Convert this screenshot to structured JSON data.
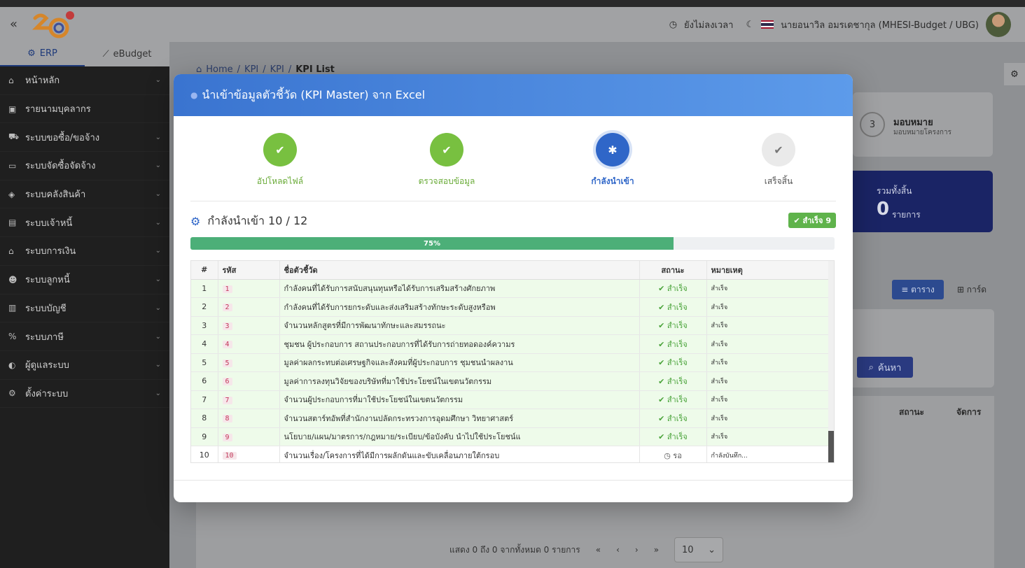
{
  "header": {
    "collapse_icon": "«",
    "clock_status": "ยังไม่ลงเวลา",
    "user_name": "นายอนาวิล อมรเดชากุล (MHESI-Budget / UBG)"
  },
  "module_tabs": [
    {
      "label": "ERP",
      "icon": "gears-icon",
      "active": true
    },
    {
      "label": "eBudget",
      "icon": "chart-line-icon",
      "active": false
    }
  ],
  "sidebar": {
    "items": [
      {
        "label": "หน้าหลัก",
        "icon": "⌂"
      },
      {
        "label": "รายนามบุคลากร",
        "icon": "▣"
      },
      {
        "label": "ระบบขอซื้อ/ขอจ้าง",
        "icon": "⛟"
      },
      {
        "label": "ระบบจัดซื้อจัดจ้าง",
        "icon": "▭"
      },
      {
        "label": "ระบบคลังสินค้า",
        "icon": "◈"
      },
      {
        "label": "ระบบเจ้าหนี้",
        "icon": "▤"
      },
      {
        "label": "ระบบการเงิน",
        "icon": "⌂"
      },
      {
        "label": "ระบบลูกหนี้",
        "icon": "☻"
      },
      {
        "label": "ระบบบัญชี",
        "icon": "▥"
      },
      {
        "label": "ระบบภาษี",
        "icon": "%"
      },
      {
        "label": "ผู้ดูแลระบบ",
        "icon": "◐"
      },
      {
        "label": "ตั้งค่าระบบ",
        "icon": "⚙"
      }
    ]
  },
  "breadcrumb": {
    "items": [
      "Home",
      "KPI",
      "KPI"
    ],
    "current": "KPI List",
    "separator": "/"
  },
  "background": {
    "step3_number": "3",
    "step3_title": "มอบหมาย",
    "step3_sub": "มอบหมายโครงการ",
    "total_label": "รวมทั้งสิ้น",
    "total_value": "0",
    "total_unit": "รายการ",
    "view_table": "≡ ตาราง",
    "view_card": "⊞ การ์ด",
    "search_label": "ค้นหา",
    "col_status": "สถานะ",
    "col_manage": "จัดการ",
    "pager_text": "แสดง 0 ถึง 0 จากทั้งหมด 0 รายการ",
    "pager_first": "«",
    "pager_prev": "‹",
    "pager_next": "›",
    "pager_last": "»",
    "page_size": "10"
  },
  "modal": {
    "title": "นำเข้าข้อมูลตัวชี้วัด (KPI Master) จาก Excel",
    "steps": [
      {
        "label": "อัปโหลดไฟล์",
        "state": "done",
        "icon": "✔"
      },
      {
        "label": "ตรวจสอบข้อมูล",
        "state": "done",
        "icon": "✔"
      },
      {
        "label": "กำลังนำเข้า",
        "state": "active",
        "icon": "✱"
      },
      {
        "label": "เสร็จสิ้น",
        "state": "pending",
        "icon": "✔"
      }
    ],
    "progress_title": "กำลังนำเข้า 10 / 12",
    "success_badge": "✔ สำเร็จ 9",
    "progress_percent": 75,
    "progress_label": "75%",
    "table": {
      "headers": [
        "#",
        "รหัส",
        "ชื่อตัวชี้วัด",
        "สถานะ",
        "หมายเหตุ"
      ],
      "rows": [
        {
          "idx": "1",
          "code": "1",
          "name": "กำลังคนที่ได้รับการสนับสนุนทุนหรือได้รับการเสริมสร้างศักยภาพ",
          "status": "สำเร็จ",
          "state": "ok",
          "note": "สำเร็จ"
        },
        {
          "idx": "2",
          "code": "2",
          "name": "กำลังคนที่ได้รับการยกระดับและส่งเสริมสร้างทักษะระดับสูงหรือพ",
          "status": "สำเร็จ",
          "state": "ok",
          "note": "สำเร็จ"
        },
        {
          "idx": "3",
          "code": "3",
          "name": "จำนวนหลักสูตรที่มีการพัฒนาทักษะและสมรรถนะ",
          "status": "สำเร็จ",
          "state": "ok",
          "note": "สำเร็จ"
        },
        {
          "idx": "4",
          "code": "4",
          "name": "ชุมชน ผู้ประกอบการ สถานประกอบการที่ได้รับการถ่ายทอดองค์ความร",
          "status": "สำเร็จ",
          "state": "ok",
          "note": "สำเร็จ"
        },
        {
          "idx": "5",
          "code": "5",
          "name": "มูลค่าผลกระทบต่อเศรษฐกิจและสังคมที่ผู้ประกอบการ ชุมชนนำผลงาน",
          "status": "สำเร็จ",
          "state": "ok",
          "note": "สำเร็จ"
        },
        {
          "idx": "6",
          "code": "6",
          "name": "มูลค่าการลงทุนวิจัยของบริษัทที่มาใช้ประโยชน์ในเขตนวัตกรรม",
          "status": "สำเร็จ",
          "state": "ok",
          "note": "สำเร็จ"
        },
        {
          "idx": "7",
          "code": "7",
          "name": "จำนวนผู้ประกอบการที่มาใช้ประโยชน์ในเขตนวัตกรรม",
          "status": "สำเร็จ",
          "state": "ok",
          "note": "สำเร็จ"
        },
        {
          "idx": "8",
          "code": "8",
          "name": "จำนวนสตาร์ทอัพที่สำนักงานปลัดกระทรวงการอุดมศึกษา วิทยาศาสตร์",
          "status": "สำเร็จ",
          "state": "ok",
          "note": "สำเร็จ"
        },
        {
          "idx": "9",
          "code": "9",
          "name": "นโยบาย/แผน/มาตรการ/กฎหมาย/ระเบียบ/ข้อบังคับ นำไปใช้ประโยชน์แ",
          "status": "สำเร็จ",
          "state": "ok",
          "note": "สำเร็จ"
        },
        {
          "idx": "10",
          "code": "10",
          "name": "จำนวนเรื่อง/โครงการที่ได้มีการผลักดันและขับเคลื่อนภายใต้กรอบ",
          "status": "รอ",
          "state": "wait",
          "note": "กำลังบันทึก..."
        }
      ]
    }
  }
}
